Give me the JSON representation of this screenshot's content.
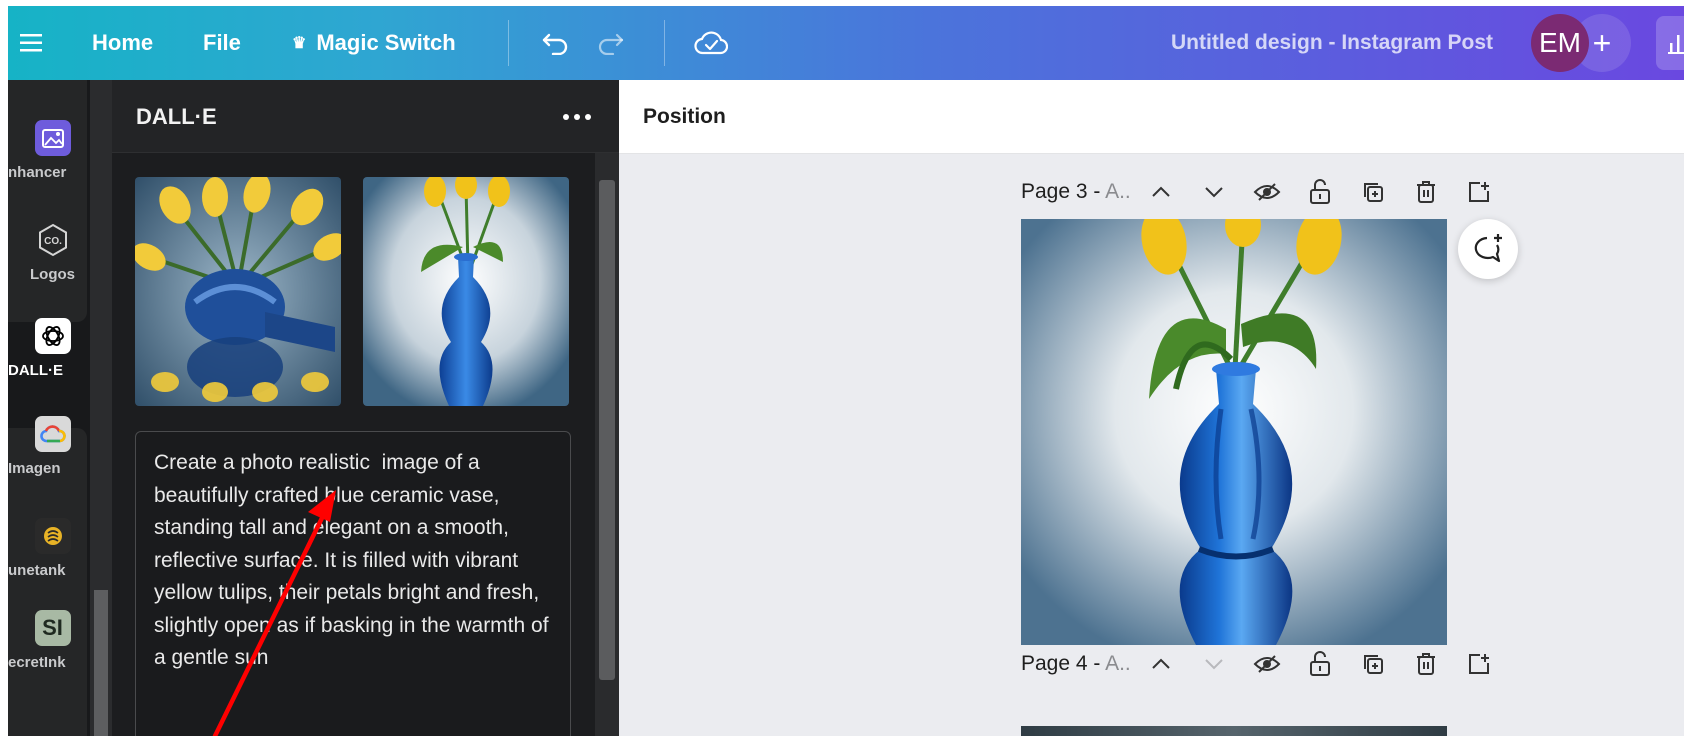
{
  "topbar": {
    "menu_icon": "hamburger-icon",
    "home_label": "Home",
    "file_label": "File",
    "magic_switch_label": "Magic Switch",
    "magic_icon": "crown-icon",
    "undo_icon": "undo-icon",
    "redo_icon": "redo-icon",
    "cloud_icon": "cloud-check-icon",
    "design_title": "Untitled design - Instagram Post",
    "avatar_initials": "EM",
    "add_label": "+",
    "share_icon": "chart-icon"
  },
  "rail": {
    "items": [
      {
        "label": "nhancer",
        "icon": "image-enhancer-icon"
      },
      {
        "label": "Logos",
        "icon": "logo-badge-icon"
      },
      {
        "label": "DALL·E",
        "icon": "openai-icon"
      },
      {
        "label": "Imagen",
        "icon": "google-cloud-icon"
      },
      {
        "label": "unetank",
        "icon": "tunetank-icon"
      },
      {
        "label": "ecretInk",
        "icon": "secretink-icon"
      }
    ]
  },
  "panel": {
    "title": "DALL·E",
    "more_icon": "more-dots-icon",
    "images": [
      "generated-image-1",
      "generated-image-2"
    ],
    "prompt": "Create a photo realistic  image of a beautifully crafted blue ceramic vase, standing tall and elegant on a smooth, reflective surface. It is filled with vibrant yellow tulips, their petals bright and fresh, slightly open as if basking in the warmth of a gentle sun"
  },
  "editor": {
    "position_label": "Position",
    "pages": [
      {
        "label": "Page 3 - ",
        "sub": "A..",
        "down_enabled": true
      },
      {
        "label": "Page 4 - ",
        "sub": "A..",
        "down_enabled": false
      }
    ],
    "page_icons": [
      "chevron-up-icon",
      "chevron-down-icon",
      "hide-icon",
      "unlock-icon",
      "duplicate-icon",
      "delete-icon",
      "add-page-icon"
    ],
    "comment_icon": "add-comment-icon"
  },
  "colors": {
    "gradient_start": "#16b3c6",
    "gradient_end": "#6a48e0",
    "avatar": "#7b2a73",
    "annotation_arrow": "#ff0000",
    "vase_blue": "#1f6fd0",
    "tulip_yellow": "#f2c414"
  }
}
